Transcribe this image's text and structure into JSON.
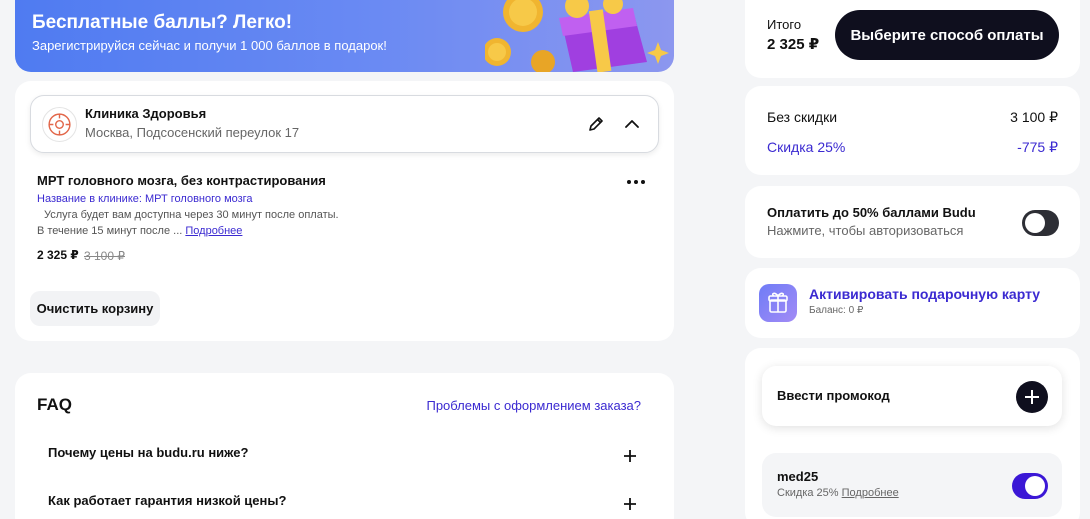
{
  "banner": {
    "title": "Бесплатные баллы? Легко!",
    "subtitle": "Зарегистрируйся сейчас и получи 1 000 баллов в подарок!"
  },
  "clinic": {
    "name": "Клиника Здоровья",
    "address": "Москва, Подсосенский переулок 17"
  },
  "service": {
    "title": "МРТ головного мозга, без контрастирования",
    "clinic_name": "Название в клинике: МРТ головного мозга",
    "availability": "Услуга будет вам доступна через 30 минут после оплаты.",
    "more_text": "В течение 15 минут после ...",
    "more_link": "Подробнее",
    "price": "2 325 ₽",
    "old_price": "3 100 ₽"
  },
  "cart": {
    "clear_label": "Очистить корзину"
  },
  "faq": {
    "title": "FAQ",
    "help_link": "Проблемы с оформлением заказа?",
    "questions": [
      "Почему цены на budu.ru ниже?",
      "Как работает гарантия низкой цены?"
    ]
  },
  "summary": {
    "total_label": "Итого",
    "total_value": "2 325 ₽",
    "pay_button": "Выберите способ оплаты",
    "no_discount_label": "Без скидки",
    "no_discount_value": "3 100 ₽",
    "discount_label": "Скидка 25%",
    "discount_value": "-775 ₽"
  },
  "points": {
    "title": "Оплатить до 50% баллами Budu",
    "subtitle": "Нажмите, чтобы авторизоваться",
    "enabled": false
  },
  "gift": {
    "title": "Активировать подарочную карту",
    "balance": "Баланс: 0 ₽"
  },
  "promo": {
    "input_label": "Ввести промокод",
    "code": "med25",
    "code_desc": "Скидка 25%",
    "code_link": "Подробнее",
    "enabled": true
  },
  "colors": {
    "accent": "#3b2ad1",
    "dark": "#0f0f1e",
    "toggle_on": "#3b17d6"
  }
}
